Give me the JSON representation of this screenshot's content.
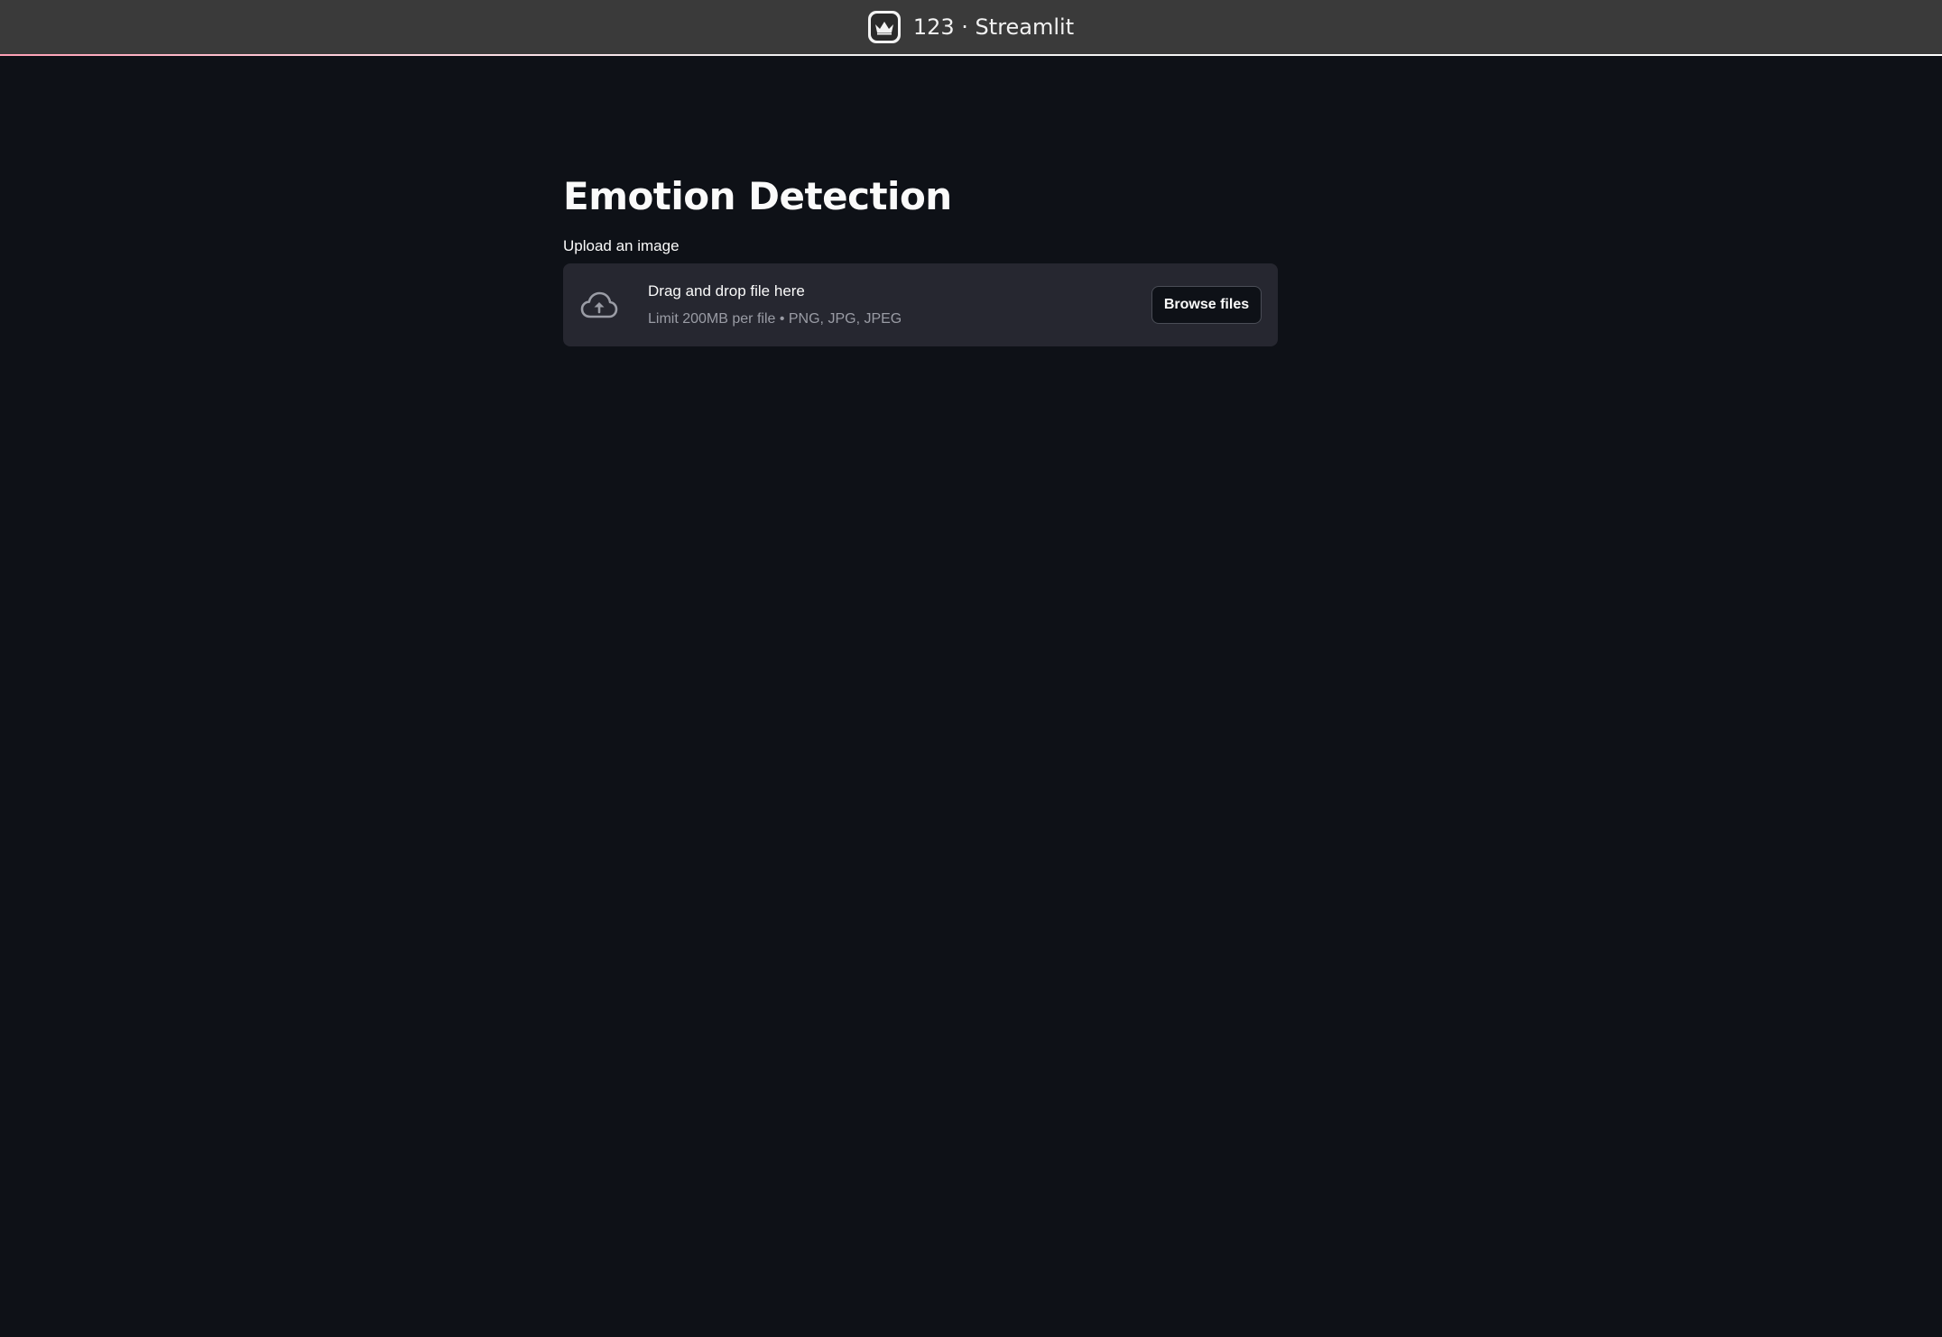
{
  "window": {
    "title": "123 · Streamlit",
    "logo_icon": "streamlit-crown-icon"
  },
  "main": {
    "title": "Emotion Detection",
    "file_uploader": {
      "label": "Upload an image",
      "instructions": "Drag and drop file here",
      "limit_text": "Limit 200MB per file • PNG, JPG, JPEG",
      "browse_button_label": "Browse files",
      "icon": "cloud-upload-icon"
    }
  },
  "colors": {
    "background": "#0e1117",
    "titlebar": "#3a3a3a",
    "dropzone": "#262730",
    "text": "#fafafa",
    "muted_text": "#9a9ca5"
  }
}
